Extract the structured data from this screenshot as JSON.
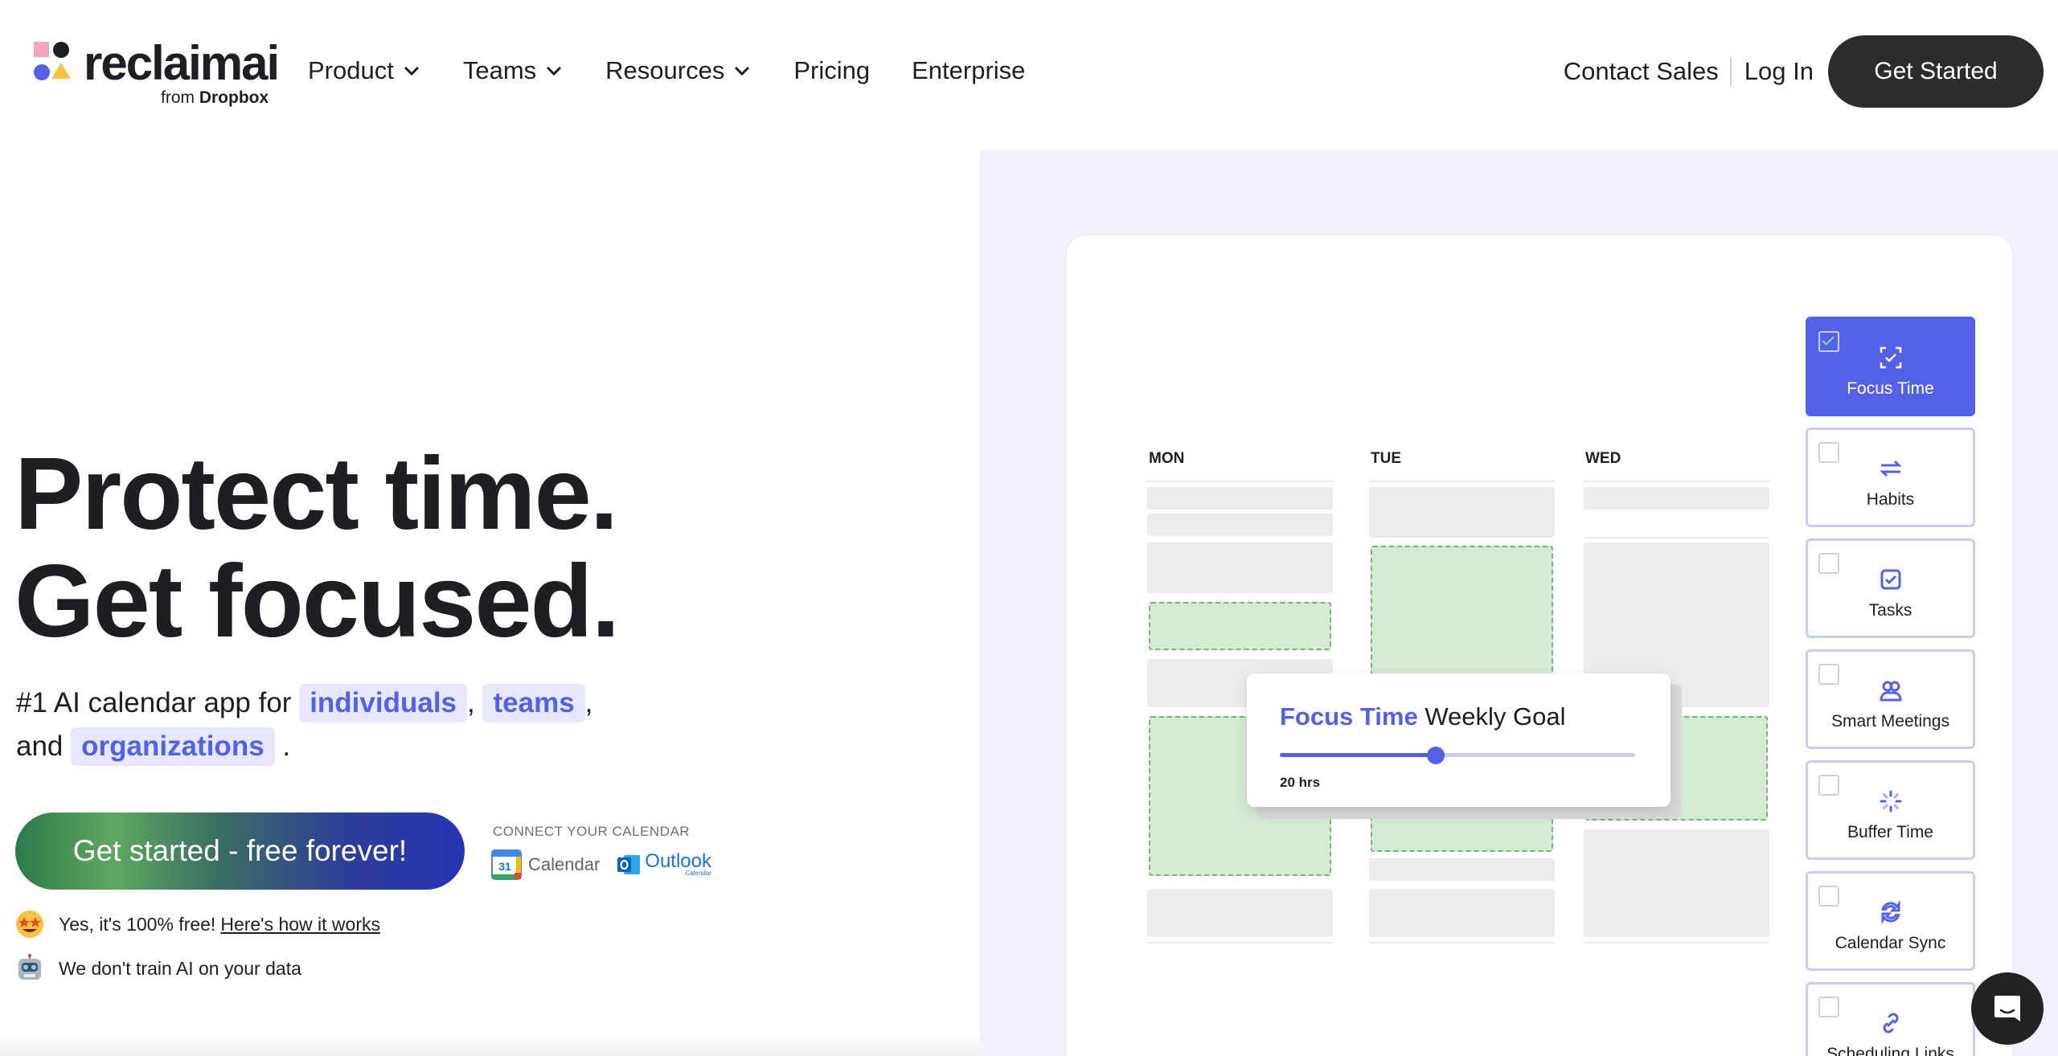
{
  "nav": {
    "logo_text": "reclaimai",
    "logo_sub_prefix": "from",
    "logo_sub_brand": "Dropbox",
    "items": [
      {
        "label": "Product",
        "dropdown": true
      },
      {
        "label": "Teams",
        "dropdown": true
      },
      {
        "label": "Resources",
        "dropdown": true
      },
      {
        "label": "Pricing",
        "dropdown": false
      },
      {
        "label": "Enterprise",
        "dropdown": false
      }
    ],
    "contact_sales": "Contact Sales",
    "log_in": "Log In",
    "get_started": "Get Started"
  },
  "hero": {
    "title_line1": "Protect time.",
    "title_line2": "Get focused.",
    "tagline_prefix": "#1 AI calendar app for",
    "chip_individuals": "individuals",
    "comma1": ",",
    "chip_teams": "teams",
    "comma2": ",",
    "and": "and",
    "chip_organizations": "organizations",
    "period": ".",
    "cta": "Get started - free forever!",
    "connect_label": "CONNECT YOUR CALENDAR",
    "gcal_label": "Calendar",
    "gcal_day": "31",
    "outlook_label": "Outlook",
    "outlook_sub": "Calendar",
    "note1_text": "Yes, it's 100% free!",
    "note1_link": "Here's how it works",
    "note2_text": "We don't train AI on your data"
  },
  "calendar": {
    "days": [
      "MON",
      "TUE",
      "WED"
    ]
  },
  "goal": {
    "accent": "Focus Time",
    "title_rest": "Weekly Goal",
    "hours_label": "20 hrs",
    "progress": 0.44
  },
  "features": [
    {
      "label": "Focus Time",
      "icon": "focus-icon",
      "active": true
    },
    {
      "label": "Habits",
      "icon": "repeat-icon",
      "active": false
    },
    {
      "label": "Tasks",
      "icon": "task-check-icon",
      "active": false
    },
    {
      "label": "Smart Meetings",
      "icon": "people-icon",
      "active": false
    },
    {
      "label": "Buffer Time",
      "icon": "spinner-icon",
      "active": false
    },
    {
      "label": "Calendar Sync",
      "icon": "sync-icon",
      "active": false
    },
    {
      "label": "Scheduling Links",
      "icon": "link-icon",
      "active": false
    }
  ],
  "colors": {
    "accent": "#5560e8",
    "dark_button": "#2b2c2e",
    "green_block": "#d3ebd3",
    "panel_bg": "#f1f2fd"
  }
}
